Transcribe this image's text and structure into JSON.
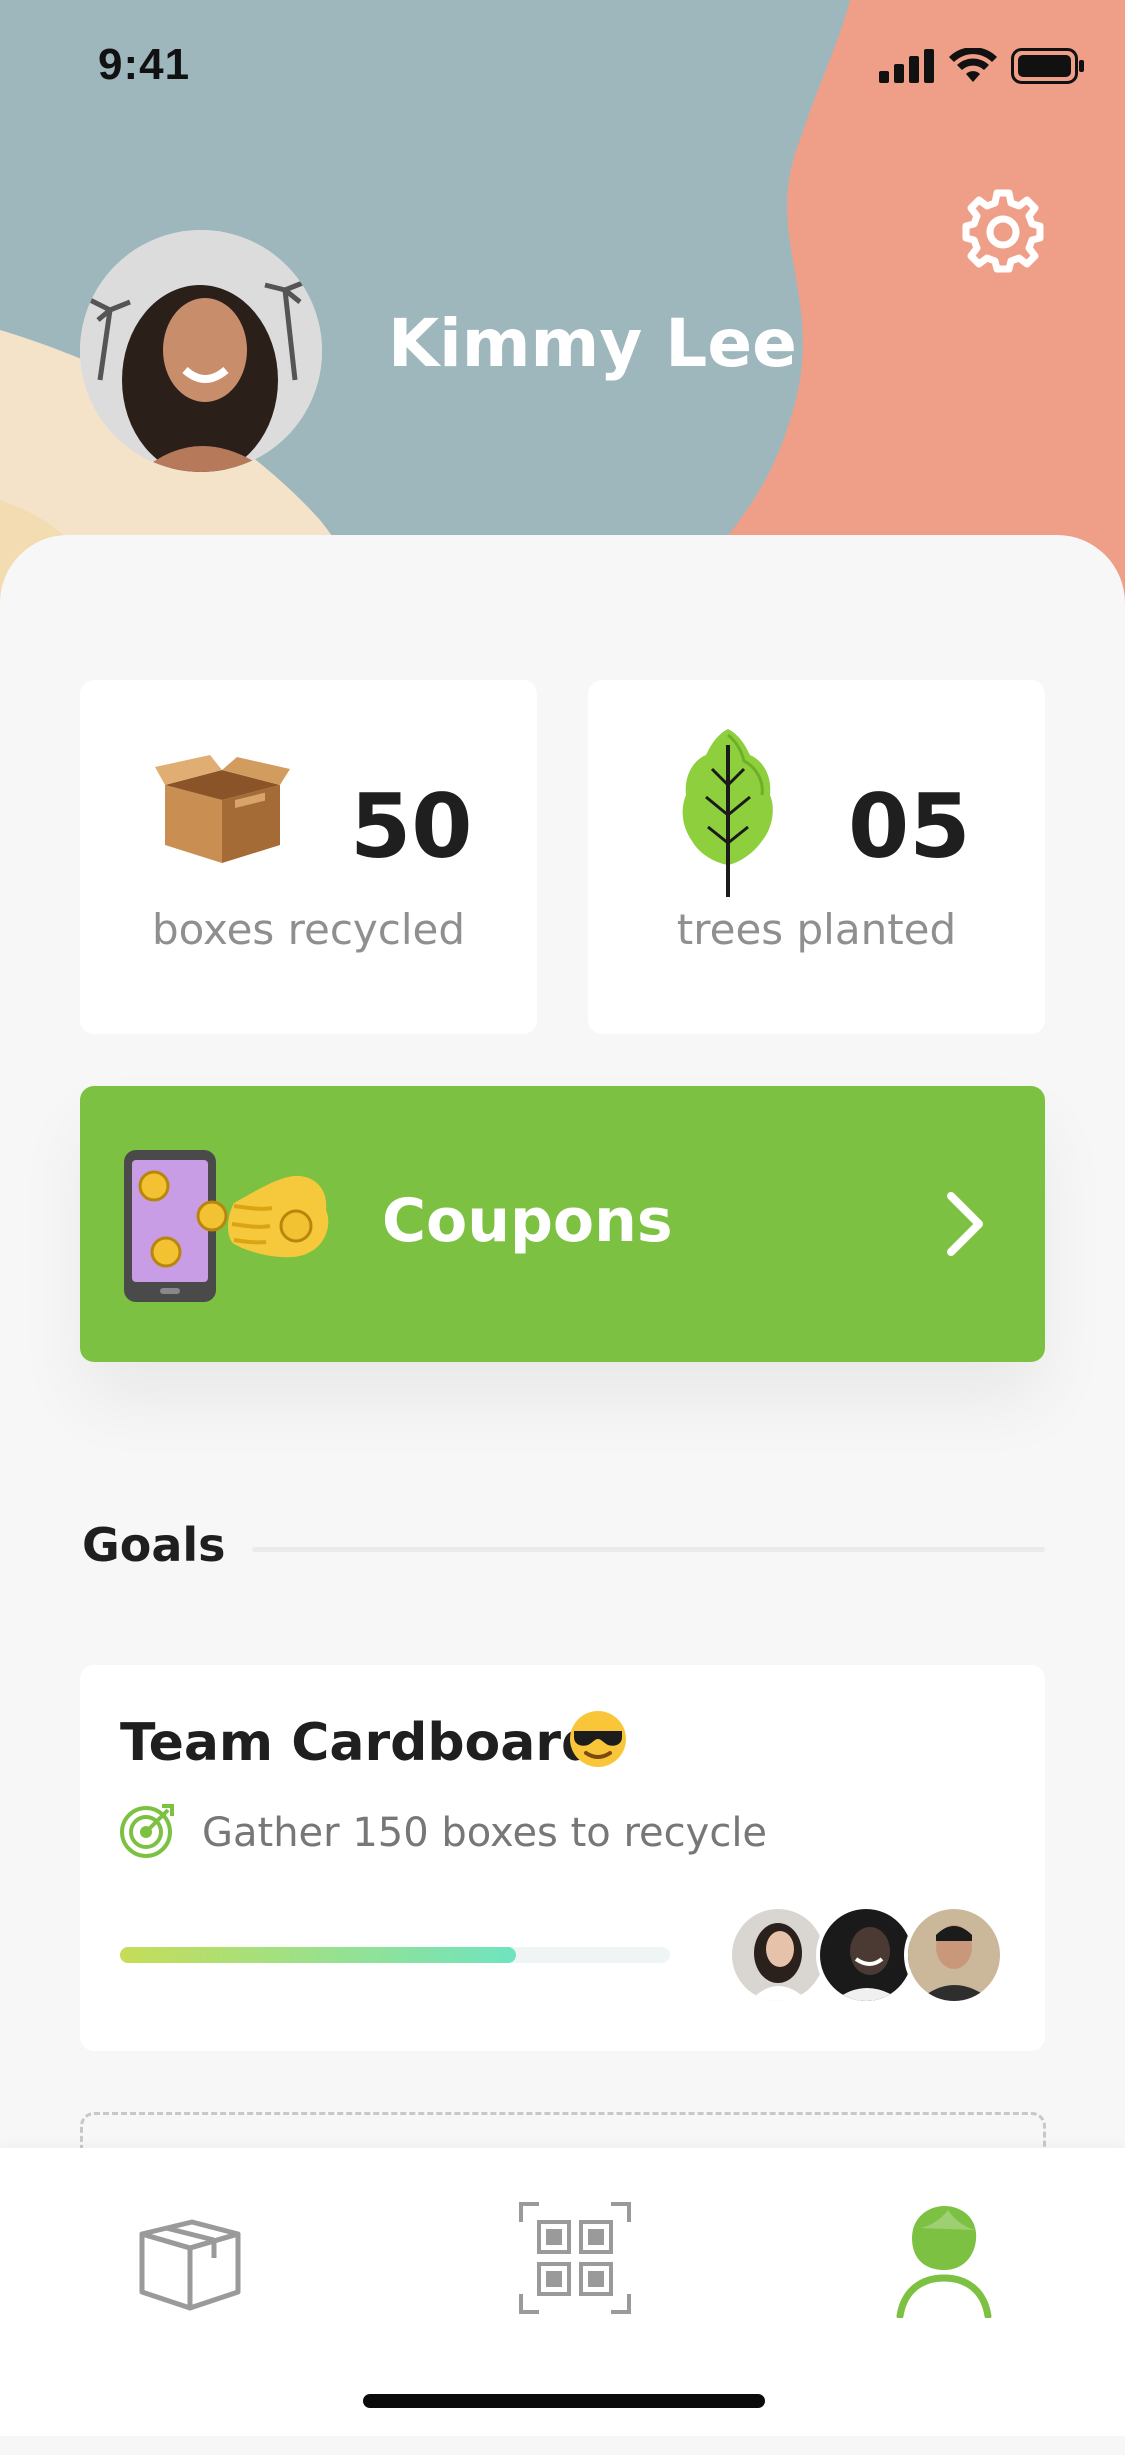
{
  "status_bar": {
    "time": "9:41"
  },
  "profile": {
    "name": "Kimmy Lee"
  },
  "stats": [
    {
      "value": "50",
      "label": "boxes recycled",
      "icon": "cardboard-box-icon"
    },
    {
      "value": "05",
      "label": "trees planted",
      "icon": "tree-icon"
    }
  ],
  "coupons": {
    "label": "Coupons",
    "icon": "phone-coins-icon"
  },
  "goals": {
    "section_title": "Goals",
    "items": [
      {
        "title": "Team Cardboard",
        "emoji": "sunglasses-emoji",
        "description": "Gather 150 boxes to recycle",
        "progress": 0.72,
        "members": [
          "member-avatar-1",
          "member-avatar-2",
          "member-avatar-3"
        ]
      }
    ]
  },
  "tabbar": {
    "tabs": [
      {
        "name": "boxes",
        "icon": "box-icon",
        "active": false
      },
      {
        "name": "scan",
        "icon": "qr-scan-icon",
        "active": false
      },
      {
        "name": "profile",
        "icon": "profile-icon",
        "active": true
      }
    ]
  },
  "colors": {
    "accent": "#7dc143",
    "header_blue": "#9eb7bd",
    "header_salmon": "#ef9f88",
    "header_cream": "#f4e3c9"
  }
}
